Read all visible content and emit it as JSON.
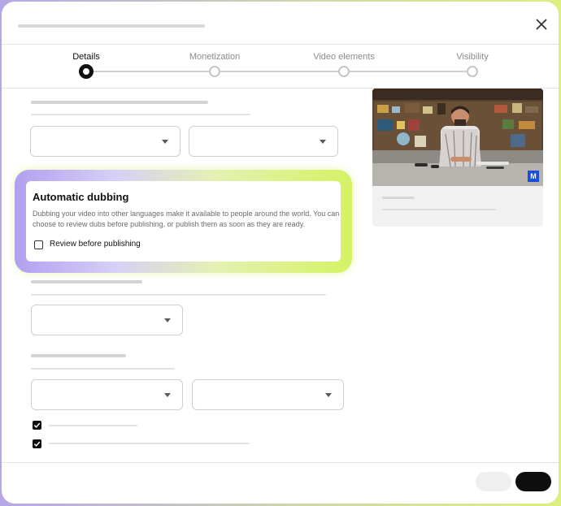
{
  "stepper": {
    "steps": [
      {
        "label": "Details",
        "active": true
      },
      {
        "label": "Monetization",
        "active": false
      },
      {
        "label": "Video elements",
        "active": false
      },
      {
        "label": "Visibility",
        "active": false
      }
    ]
  },
  "dubbing": {
    "title": "Automatic dubbing",
    "description": "Dubbing your video into other languages make it available to people around the world. You can choose to review dubs before publishing, or publish them as soon as they are ready.",
    "checkbox_label": "Review before publishing",
    "checkbox_checked": false
  },
  "preview": {
    "badge": "M"
  },
  "checkboxes": [
    {
      "checked": true
    },
    {
      "checked": true
    }
  ],
  "icons": {
    "close": "close-icon",
    "dropdown": "chevron-down-icon",
    "check": "check-icon"
  },
  "colors": {
    "accent_dark": "#0f0f0f",
    "glow_start": "#b29ff0",
    "glow_end": "#d4f263",
    "badge_blue": "#1b4fd8"
  }
}
